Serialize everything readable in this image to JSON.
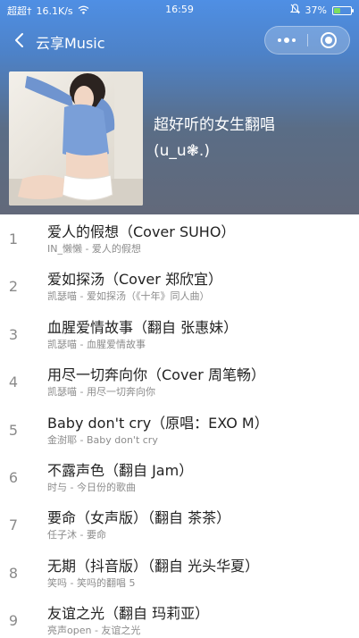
{
  "status_bar": {
    "carrier": "超超†",
    "speed": "16.1K/s",
    "time": "16:59",
    "battery_text": "37%",
    "battery_level": 0.37
  },
  "nav": {
    "title": "云享Music"
  },
  "playlist": {
    "title_line1": "超好听的女生翻唱",
    "title_line2": "(u_u❃.)"
  },
  "songs": [
    {
      "num": "1",
      "title": "爱人的假想（Cover SUHO）",
      "sub": "IN_懒懒 - 爱人的假想"
    },
    {
      "num": "2",
      "title": "爱如探汤（Cover 郑欣宜）",
      "sub": "凯瑟喵 - 爱如探汤（《十年》同人曲）"
    },
    {
      "num": "3",
      "title": "血腥爱情故事（翻自 张惠妹）",
      "sub": "凯瑟喵 - 血腥爱情故事"
    },
    {
      "num": "4",
      "title": "用尽一切奔向你（Cover 周笔畅）",
      "sub": "凯瑟喵 - 用尽一切奔向你"
    },
    {
      "num": "5",
      "title": "Baby don't cry（原唱：EXO M）",
      "sub": "金澍耶 - Baby don't cry"
    },
    {
      "num": "6",
      "title": "不露声色（翻自 Jam）",
      "sub": "时与 - 今日份的歌曲"
    },
    {
      "num": "7",
      "title": "要命（女声版）（翻自 茶茶）",
      "sub": "任子沐 - 要命"
    },
    {
      "num": "8",
      "title": "无期（抖音版）（翻自 光头华夏）",
      "sub": "笑吗 - 笑吗的翻唱 5"
    },
    {
      "num": "9",
      "title": "友谊之光（翻自 玛莉亚）",
      "sub": "亮声open - 友谊之光"
    }
  ],
  "colors": {
    "nav_blue": "#4f8fe4",
    "header_gray": "#62697a",
    "battery_green": "#7dde5f"
  },
  "icons": [
    "signal-icon",
    "wifi-icon",
    "mute-icon",
    "battery-icon",
    "back-arrow-icon",
    "more-icon",
    "close-mini-program-icon"
  ]
}
